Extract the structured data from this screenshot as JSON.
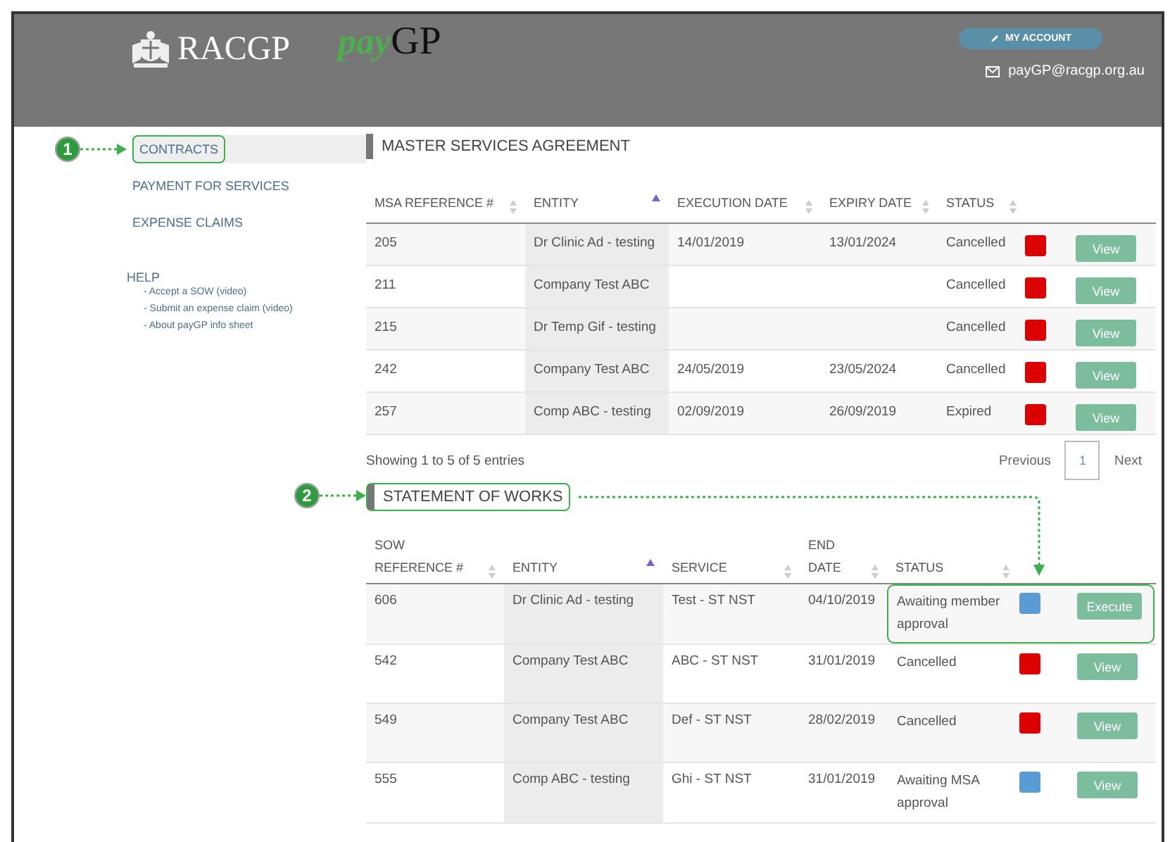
{
  "header": {
    "org": "RACGP",
    "product_prefix": "pay",
    "product_suffix": "GP",
    "account_button": "MY ACCOUNT",
    "email": "payGP@racgp.org.au"
  },
  "sidebar": {
    "callout": "1",
    "items": [
      {
        "label": "CONTRACTS",
        "selected": true
      },
      {
        "label": "PAYMENT FOR SERVICES",
        "selected": false
      },
      {
        "label": "EXPENSE CLAIMS",
        "selected": false
      }
    ],
    "help": {
      "title": "HELP",
      "links": [
        "- Accept a SOW (video)",
        "- Submit an expense claim (video)",
        "- About payGP info sheet"
      ]
    }
  },
  "msa": {
    "title": "MASTER SERVICES AGREEMENT",
    "columns": [
      {
        "label": "MSA REFERENCE #",
        "sorted": false
      },
      {
        "label": "ENTITY",
        "sorted": true
      },
      {
        "label": "EXECUTION DATE",
        "sorted": false
      },
      {
        "label": "EXPIRY DATE",
        "sorted": false
      },
      {
        "label": "STATUS",
        "sorted": false
      }
    ],
    "rows": [
      {
        "cells": [
          "205",
          "Dr Clinic Ad - testing",
          "14/01/2019",
          "13/01/2024",
          "Cancelled"
        ],
        "color": "#dd0000",
        "action": "View"
      },
      {
        "cells": [
          "211",
          "Company Test ABC",
          "",
          "",
          "Cancelled"
        ],
        "color": "#dd0000",
        "action": "View"
      },
      {
        "cells": [
          "215",
          "Dr Temp Gif - testing",
          "",
          "",
          "Cancelled"
        ],
        "color": "#dd0000",
        "action": "View"
      },
      {
        "cells": [
          "242",
          "Company Test ABC",
          "24/05/2019",
          "23/05/2024",
          "Cancelled"
        ],
        "color": "#dd0000",
        "action": "View"
      },
      {
        "cells": [
          "257",
          "Comp ABC - testing",
          "02/09/2019",
          "26/09/2019",
          "Expired"
        ],
        "color": "#dd0000",
        "action": "View"
      }
    ],
    "info": "Showing 1 to 5 of 5 entries",
    "pagination": {
      "previous": "Previous",
      "pages": [
        {
          "label": "1",
          "selected": true
        }
      ],
      "next": "Next"
    }
  },
  "sow": {
    "title": "STATEMENT OF WORKS",
    "callout": "2",
    "columns": [
      {
        "label": "SOW REFERENCE #",
        "sorted": false
      },
      {
        "label": "ENTITY",
        "sorted": true
      },
      {
        "label": "SERVICE",
        "sorted": false
      },
      {
        "label": "END DATE",
        "sorted": false
      },
      {
        "label": "STATUS",
        "sorted": false
      }
    ],
    "rows": [
      {
        "cells": [
          "606",
          "Dr Clinic Ad - testing",
          "Test - ST NST",
          "04/10/2019",
          "Awaiting member approval"
        ],
        "color": "#5b9bd5",
        "action": "Execute",
        "highlighted": true
      },
      {
        "cells": [
          "542",
          "Company Test ABC",
          "ABC - ST NST",
          "31/01/2019",
          "Cancelled"
        ],
        "color": "#dd0000",
        "action": "View",
        "highlighted": false
      },
      {
        "cells": [
          "549",
          "Company Test ABC",
          "Def - ST NST",
          "28/02/2019",
          "Cancelled"
        ],
        "color": "#dd0000",
        "action": "View",
        "highlighted": false
      },
      {
        "cells": [
          "555",
          "Comp ABC - testing",
          "Ghi - ST NST",
          "31/01/2019",
          "Awaiting MSA approval"
        ],
        "color": "#5b9bd5",
        "action": "View",
        "highlighted": false
      }
    ]
  }
}
